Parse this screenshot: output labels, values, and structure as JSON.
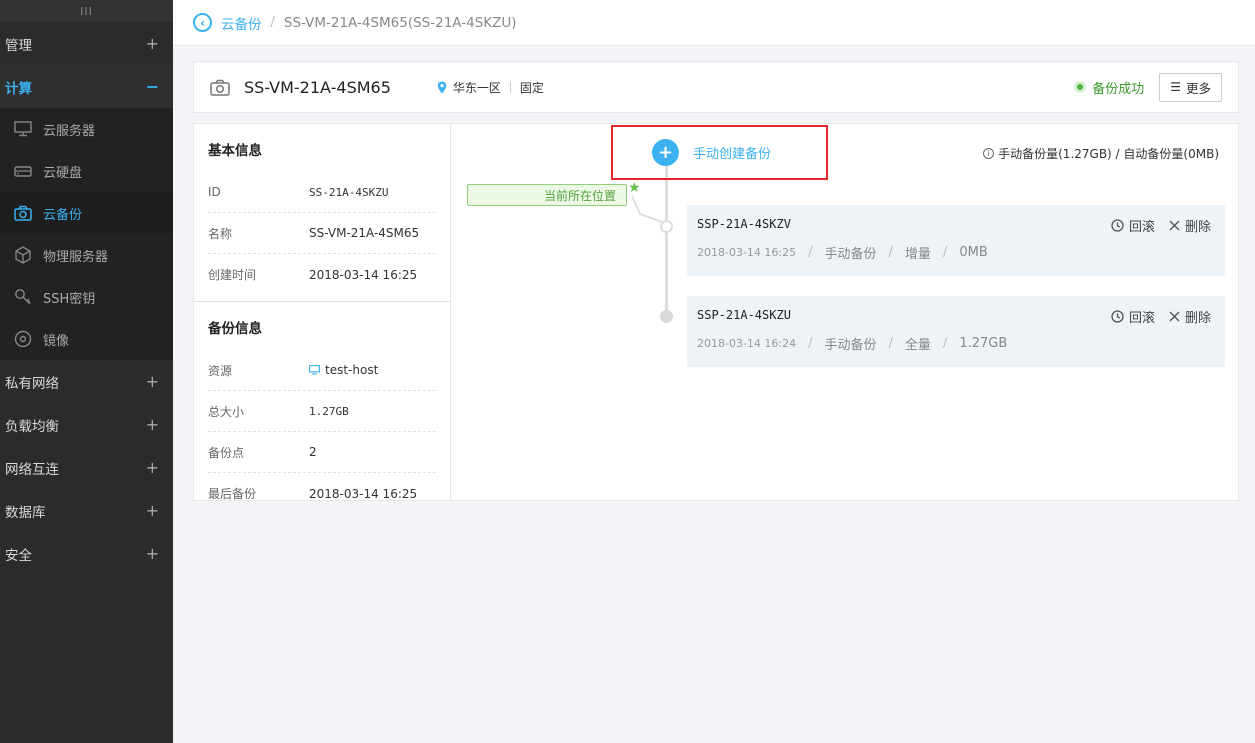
{
  "sidebar": {
    "handle": "III",
    "groups_top": [
      {
        "label": "管理",
        "toggle": "+"
      }
    ],
    "compute": {
      "label": "计算",
      "toggle": "−",
      "items": [
        {
          "label": "云服务器",
          "icon": "monitor-icon"
        },
        {
          "label": "云硬盘",
          "icon": "disk-icon"
        },
        {
          "label": "云备份",
          "icon": "camera-icon"
        },
        {
          "label": "物理服务器",
          "icon": "cube-icon"
        },
        {
          "label": "SSH密钥",
          "icon": "key-icon"
        },
        {
          "label": "镜像",
          "icon": "disc-icon"
        }
      ]
    },
    "groups_bottom": [
      {
        "label": "私有网络",
        "toggle": "+"
      },
      {
        "label": "负载均衡",
        "toggle": "+"
      },
      {
        "label": "网络互连",
        "toggle": "+"
      },
      {
        "label": "数据库",
        "toggle": "+"
      },
      {
        "label": "安全",
        "toggle": "+"
      }
    ]
  },
  "breadcrumb": {
    "parent": "云备份",
    "separator": "/",
    "current": "SS-VM-21A-4SM65(SS-21A-4SKZU)"
  },
  "header": {
    "title": "SS-VM-21A-4SM65",
    "region": "华东一区",
    "type": "固定",
    "status": "备份成功",
    "more_icon": "☰",
    "more_label": "更多"
  },
  "basic_info": {
    "title": "基本信息",
    "rows": [
      {
        "key": "ID",
        "value": "SS-21A-4SKZU"
      },
      {
        "key": "名称",
        "value": "SS-VM-21A-4SM65"
      },
      {
        "key": "创建时间",
        "value": "2018-03-14 16:25"
      }
    ]
  },
  "backup_info": {
    "title": "备份信息",
    "resource_key": "资源",
    "resource_value": "test-host",
    "rows": [
      {
        "key": "总大小",
        "value": "1.27GB"
      },
      {
        "key": "备份点",
        "value": "2"
      },
      {
        "key": "最后备份",
        "value": "2018-03-14 16:25"
      }
    ]
  },
  "timeline": {
    "create_label": "手动创建备份",
    "quota_text": "手动备份量(1.27GB) / 自动备份量(0MB)",
    "current_tag": "当前所在位置",
    "meta_separator": "/",
    "snapshots": [
      {
        "name": "SSP-21A-4SKZV",
        "time": "2018-03-14 16:25",
        "kind": "手动备份",
        "mode": "增量",
        "size": "0MB",
        "rollback": "回滚",
        "delete": "删除"
      },
      {
        "name": "SSP-21A-4SKZU",
        "time": "2018-03-14 16:24",
        "kind": "手动备份",
        "mode": "全量",
        "size": "1.27GB",
        "rollback": "回滚",
        "delete": "删除"
      }
    ]
  },
  "colors": {
    "accent": "#3bb1f0",
    "success": "#52b33f",
    "highlight": "#e4262b"
  }
}
